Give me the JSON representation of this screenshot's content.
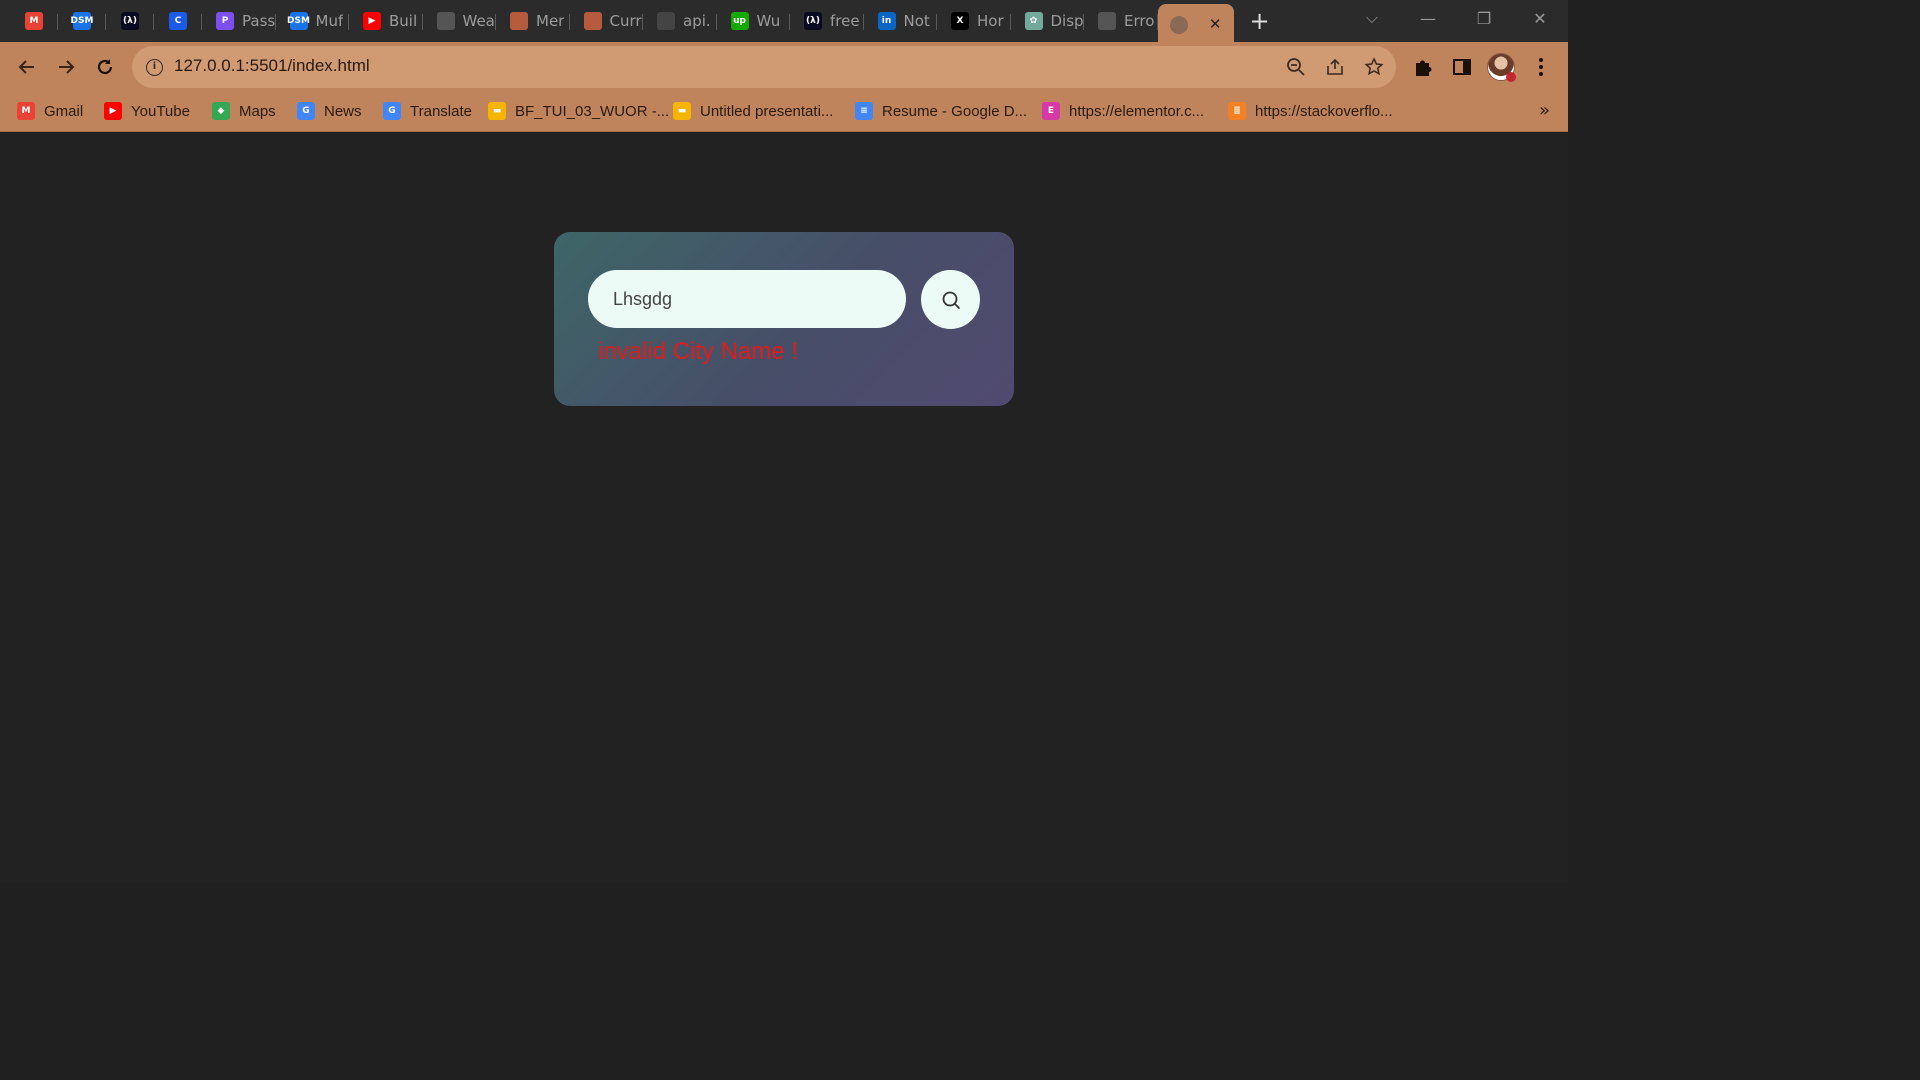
{
  "browser": {
    "tabs": [
      {
        "title": "",
        "icon": "gmail-icon",
        "color": "#ea4335",
        "glyph": "M",
        "pinned": true
      },
      {
        "title": "",
        "icon": "dsm-icon",
        "color": "#1a73e8",
        "glyph": "DSM",
        "pinned": true
      },
      {
        "title": "",
        "icon": "freecodecamp-icon",
        "color": "#0a0a23",
        "glyph": "(λ)",
        "pinned": true
      },
      {
        "title": "",
        "icon": "c-app-icon",
        "color": "#1a5be8",
        "glyph": "C",
        "pinned": true
      },
      {
        "title": "Pass",
        "icon": "pass-app-icon",
        "color": "#7b4ff0",
        "glyph": "P"
      },
      {
        "title": "Muf",
        "icon": "dsm-icon",
        "color": "#1a73e8",
        "glyph": "DSM"
      },
      {
        "title": "Buil",
        "icon": "youtube-icon",
        "color": "#ff0000",
        "glyph": "▶"
      },
      {
        "title": "Wea",
        "icon": "globe-icon",
        "color": "#555555",
        "glyph": ""
      },
      {
        "title": "Mer",
        "icon": "chrome-red-icon",
        "color": "#b55a3c",
        "glyph": ""
      },
      {
        "title": "Curr",
        "icon": "chrome-red-icon",
        "color": "#b55a3c",
        "glyph": ""
      },
      {
        "title": "api.",
        "icon": "globe-dark-icon",
        "color": "#444444",
        "glyph": ""
      },
      {
        "title": "Wu",
        "icon": "upwork-icon",
        "color": "#14a800",
        "glyph": "up"
      },
      {
        "title": "free",
        "icon": "freecodecamp-icon",
        "color": "#0a0a23",
        "glyph": "(λ)"
      },
      {
        "title": "Not",
        "icon": "linkedin-icon",
        "color": "#0a66c2",
        "glyph": "in"
      },
      {
        "title": "Hor",
        "icon": "x-twitter-icon",
        "color": "#000000",
        "glyph": "X"
      },
      {
        "title": "Disp",
        "icon": "chatgpt-icon",
        "color": "#74aa9c",
        "glyph": "✿"
      },
      {
        "title": "Erro",
        "icon": "globe-icon",
        "color": "#555555",
        "glyph": ""
      }
    ],
    "active_tab": {
      "icon": "globe-icon",
      "close": "✕"
    },
    "new_tab": "+",
    "url": "127.0.0.1:5501/index.html",
    "bookmarks": [
      {
        "label": "Gmail",
        "icon": "gmail-icon",
        "color": "#ea4335",
        "glyph": "M"
      },
      {
        "label": "YouTube",
        "icon": "youtube-icon",
        "color": "#ff0000",
        "glyph": "▶"
      },
      {
        "label": "Maps",
        "icon": "maps-icon",
        "color": "#34a853",
        "glyph": "◆"
      },
      {
        "label": "News",
        "icon": "news-icon",
        "color": "#4285f4",
        "glyph": "G"
      },
      {
        "label": "Translate",
        "icon": "translate-icon",
        "color": "#4285f4",
        "glyph": "G"
      },
      {
        "label": "BF_TUI_03_WUOR -...",
        "icon": "slides-icon",
        "color": "#f4b400",
        "glyph": "▬"
      },
      {
        "label": "Untitled presentati...",
        "icon": "slides-icon",
        "color": "#f4b400",
        "glyph": "▬"
      },
      {
        "label": "Resume - Google D...",
        "icon": "docs-icon",
        "color": "#4285f4",
        "glyph": "≡"
      },
      {
        "label": "https://elementor.c...",
        "icon": "elementor-icon",
        "color": "#d63aa8",
        "glyph": "E"
      },
      {
        "label": "https://stackoverflo...",
        "icon": "stackoverflow-icon",
        "color": "#f48024",
        "glyph": "≣"
      }
    ],
    "bookmarks_more": "»"
  },
  "app": {
    "search_value": "Lhsgdg",
    "error_message": "invalid City Name !",
    "colors": {
      "page_bg": "#222222",
      "card_gradient_start": "#3e6667",
      "card_gradient_end": "#514a70",
      "input_bg": "#edfbf6",
      "error": "#e21a1a"
    }
  }
}
